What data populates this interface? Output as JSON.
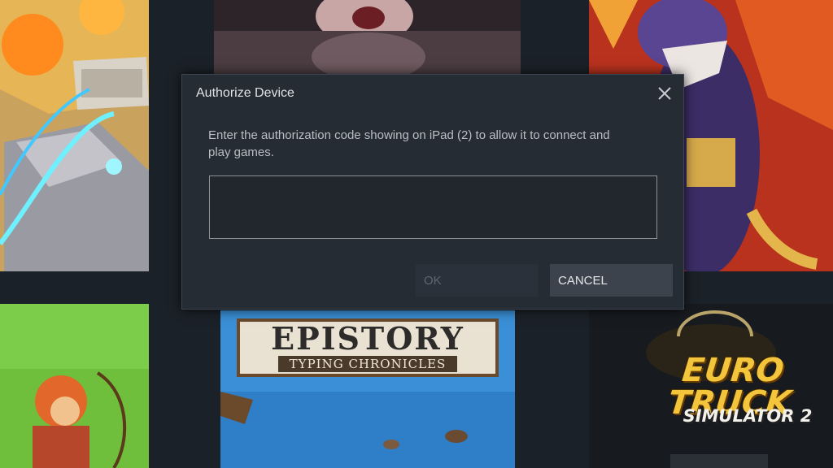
{
  "dialog": {
    "title": "Authorize Device",
    "message": "Enter the authorization code showing on iPad (2) to allow it to connect and play games.",
    "code_value": "",
    "code_placeholder": "",
    "ok_label": "OK",
    "ok_enabled": false,
    "cancel_label": "CANCEL",
    "close_icon": "close-icon"
  },
  "library": {
    "tiles": [
      {
        "name": "game-art-top-left",
        "text": ""
      },
      {
        "name": "game-art-top-center",
        "text": ""
      },
      {
        "name": "game-art-top-right",
        "text": ""
      },
      {
        "name": "game-art-bottom-left",
        "text": ""
      },
      {
        "name": "game-art-epistory",
        "title": "EPISTORY",
        "subtitle": "TYPING CHRONICLES"
      },
      {
        "name": "game-art-euro-truck",
        "title": "EURO TRUCK",
        "subtitle": "SIMULATOR 2"
      }
    ]
  },
  "colors": {
    "background": "#1b2128",
    "dialog_bg": "#262c34",
    "text_primary": "#dfe3e6",
    "text_secondary": "#b9bec5",
    "button_disabled_text": "#5e656e",
    "button_cancel_bg": "#3d434c"
  }
}
